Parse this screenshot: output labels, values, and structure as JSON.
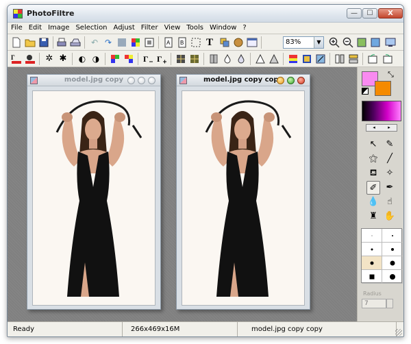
{
  "window": {
    "title": "PhotoFiltre",
    "min_glyph": "—",
    "max_glyph": "☐",
    "close_glyph": "X"
  },
  "menu": [
    "File",
    "Edit",
    "Image",
    "Selection",
    "Adjust",
    "Filter",
    "View",
    "Tools",
    "Window",
    "?"
  ],
  "toolbar": {
    "zoom_value": "83%",
    "zoom_arrow": "▼"
  },
  "documents": [
    {
      "title": "model.jpg copy",
      "active": false
    },
    {
      "title": "model.jpg copy copy",
      "active": true
    }
  ],
  "palette": {
    "foreground": "#f98af0",
    "background": "#f58a00",
    "nav_prev": "◂",
    "nav_next": "▸"
  },
  "tools": {
    "radius_label": "Radius",
    "radius_value": "7"
  },
  "status": {
    "ready": "Ready",
    "size": "266x469x16M",
    "file": "model.jpg copy copy"
  }
}
